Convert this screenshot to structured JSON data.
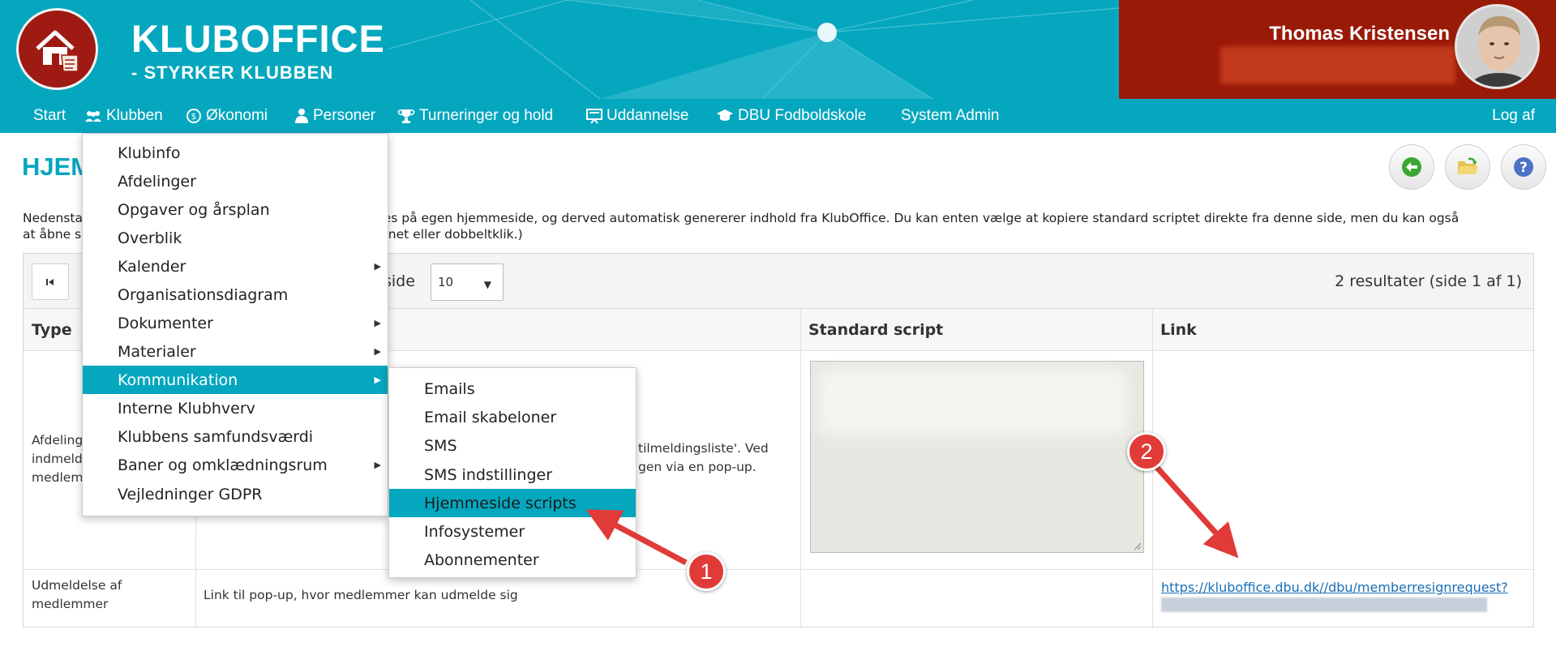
{
  "header": {
    "brand_title": "KLUBOFFICE",
    "brand_subtitle": "- STYRKER KLUBBEN",
    "user_name": "Thomas Kristensen",
    "colors": {
      "teal": "#05a7bf",
      "brand_red": "#9a1a08",
      "accent": "#e03b38"
    }
  },
  "nav": {
    "items": [
      {
        "label": "Start",
        "icon": ""
      },
      {
        "label": "Klubben",
        "icon": "people-icon"
      },
      {
        "label": "Økonomi",
        "icon": "coin-icon"
      },
      {
        "label": "Personer",
        "icon": "person-icon"
      },
      {
        "label": "Turneringer og hold",
        "icon": "trophy-icon"
      },
      {
        "label": "Uddannelse",
        "icon": "presentation-icon"
      },
      {
        "label": "DBU Fodboldskole",
        "icon": "graduation-cap-icon"
      },
      {
        "label": "System Admin",
        "icon": ""
      }
    ],
    "logout": "Log af"
  },
  "page": {
    "title": "HJEM",
    "intro_left_1": "Nedensta",
    "intro_right_1": "ettes på egen hjemmeside, og derved automatisk genererer indhold fra KlubOffice. Du kan enten vælge at kopiere standard scriptet direkte fra denne side, men du kan også",
    "intro_left_2": "at åbne s",
    "intro_right_2": "-ikonet eller dobbeltklik.)"
  },
  "table": {
    "per_page_label": "side",
    "per_page_value": "10",
    "results": "2 resultater (side 1 af 1)",
    "columns": {
      "type": "Type",
      "script": "Standard script",
      "link": "Link"
    },
    "rows": [
      {
        "type_lines": [
          "Afdeling",
          "indmeld",
          "medlem"
        ],
        "desc_lines": [
          "tilmeldingsliste'. Ved",
          "gen via en pop-up."
        ]
      },
      {
        "type_lines": [
          "Udmeldelse af",
          "medlemmer"
        ],
        "desc": "Link til pop-up, hvor medlemmer kan udmelde sig",
        "link": "https://kluboffice.dbu.dk//dbu/memberresignrequest?"
      }
    ]
  },
  "menu": {
    "items": [
      {
        "label": "Klubinfo",
        "submenu": false
      },
      {
        "label": "Afdelinger",
        "submenu": false
      },
      {
        "label": "Opgaver og årsplan",
        "submenu": false
      },
      {
        "label": "Overblik",
        "submenu": false
      },
      {
        "label": "Kalender",
        "submenu": true
      },
      {
        "label": "Organisationsdiagram",
        "submenu": false
      },
      {
        "label": "Dokumenter",
        "submenu": true
      },
      {
        "label": "Materialer",
        "submenu": true
      },
      {
        "label": "Kommunikation",
        "submenu": true
      },
      {
        "label": "Interne Klubhverv",
        "submenu": false
      },
      {
        "label": "Klubbens samfundsværdi",
        "submenu": false
      },
      {
        "label": "Baner og omklædningsrum",
        "submenu": true
      },
      {
        "label": "Vejledninger GDPR",
        "submenu": false
      }
    ],
    "active_index": 8
  },
  "submenu": {
    "items": [
      "Emails",
      "Email skabeloner",
      "SMS",
      "SMS indstillinger",
      "Hjemmeside scripts",
      "Infosystemer",
      "Abonnementer"
    ],
    "active_index": 4
  },
  "annotations": {
    "badge1": "1",
    "badge2": "2"
  }
}
